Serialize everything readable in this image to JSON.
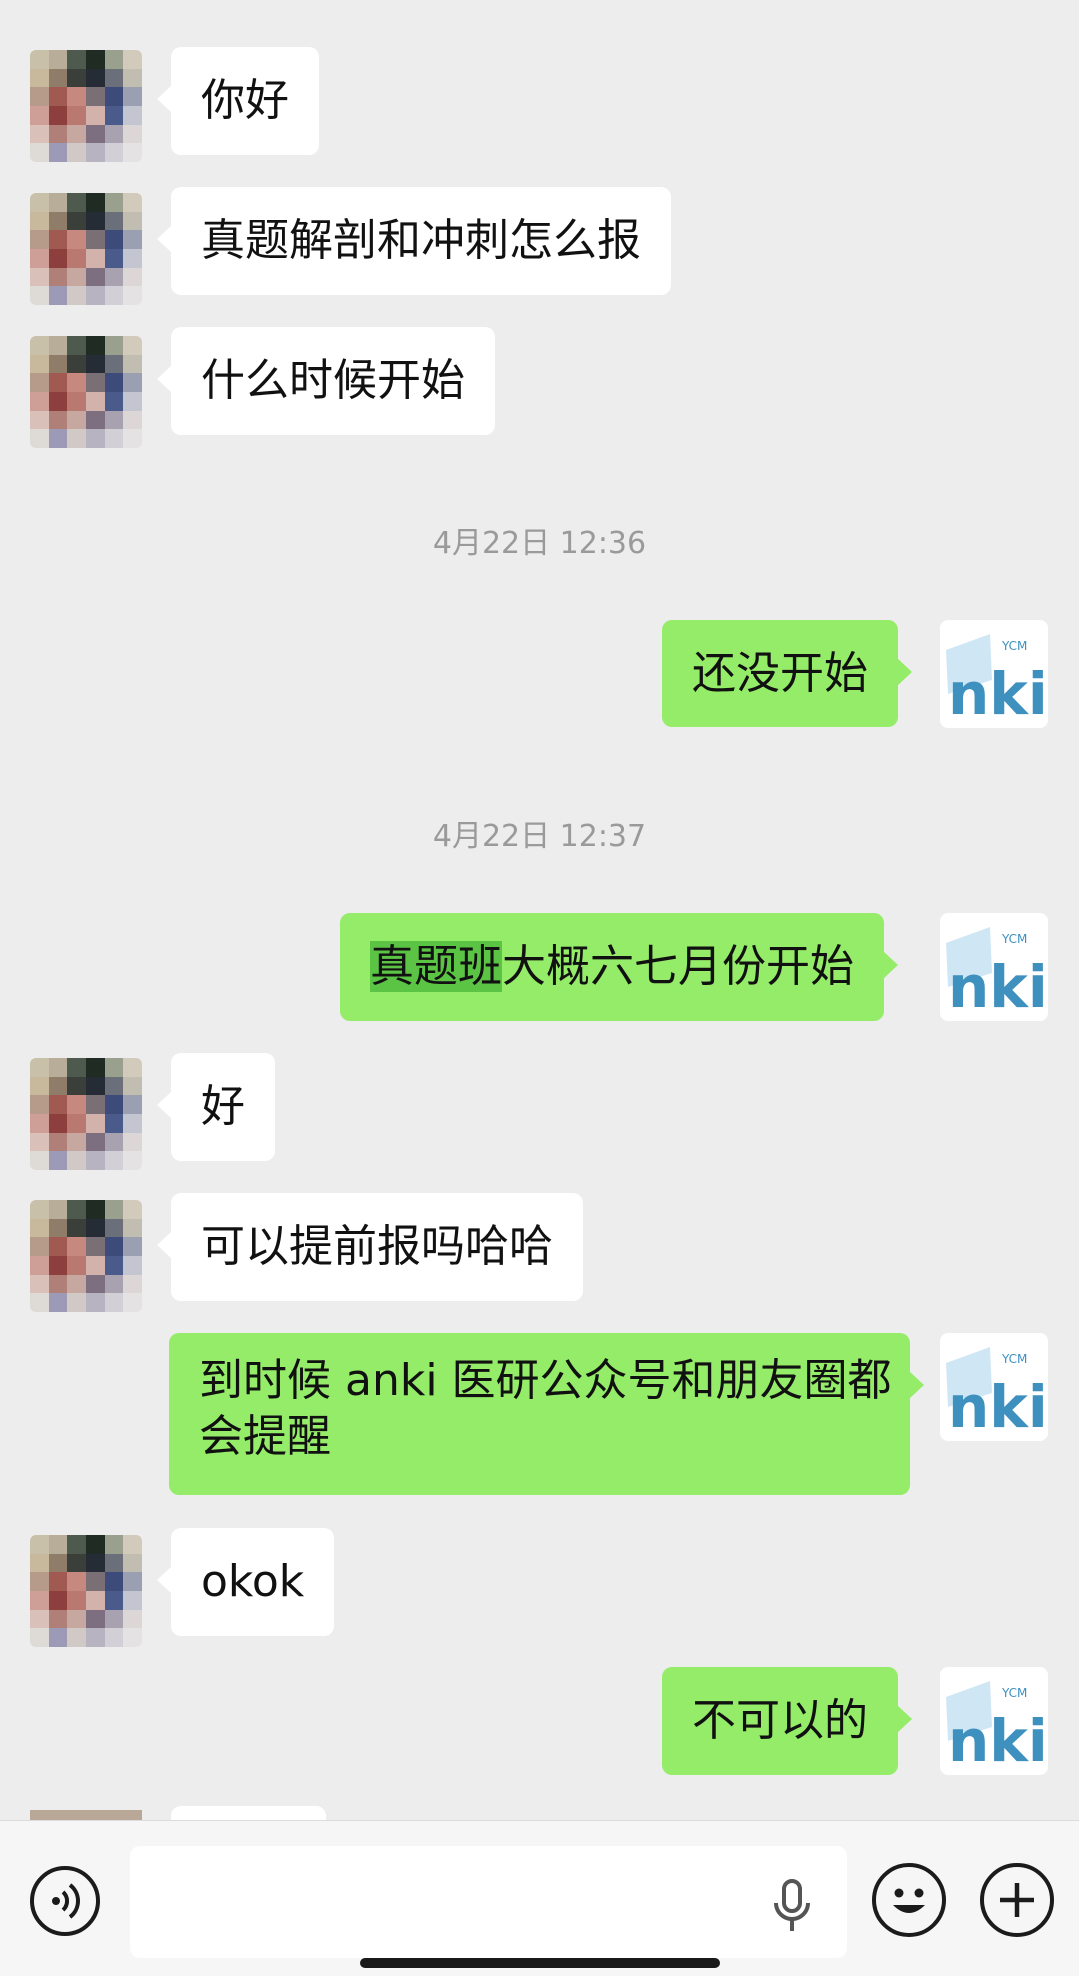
{
  "chat": {
    "messages": [
      {
        "side": "in",
        "text": "你好"
      },
      {
        "side": "in",
        "text": "真题解剖和冲刺怎么报"
      },
      {
        "side": "in",
        "text": "什么时候开始"
      },
      {
        "side": "time",
        "text": "4月22日 12:36"
      },
      {
        "side": "out",
        "text": "还没开始"
      },
      {
        "side": "time",
        "text": "4月22日 12:37"
      },
      {
        "side": "out",
        "highlight": "真题班",
        "text": "大概六七月份开始"
      },
      {
        "side": "in",
        "text": "好"
      },
      {
        "side": "in",
        "text": "可以提前报吗哈哈"
      },
      {
        "side": "out",
        "line1": "到时候 anki 医研公众号和朋友圈都",
        "line2": "会提醒"
      },
      {
        "side": "in",
        "text": "okok"
      },
      {
        "side": "out",
        "text": "不可以的"
      }
    ]
  },
  "self_avatar": {
    "logo_text": "nki",
    "logo_small": "YCM"
  },
  "input_bar": {
    "placeholder": ""
  },
  "icons": {
    "voice": "voice-icon",
    "mic": "mic-icon",
    "emoji": "emoji-icon",
    "plus": "plus-icon"
  }
}
